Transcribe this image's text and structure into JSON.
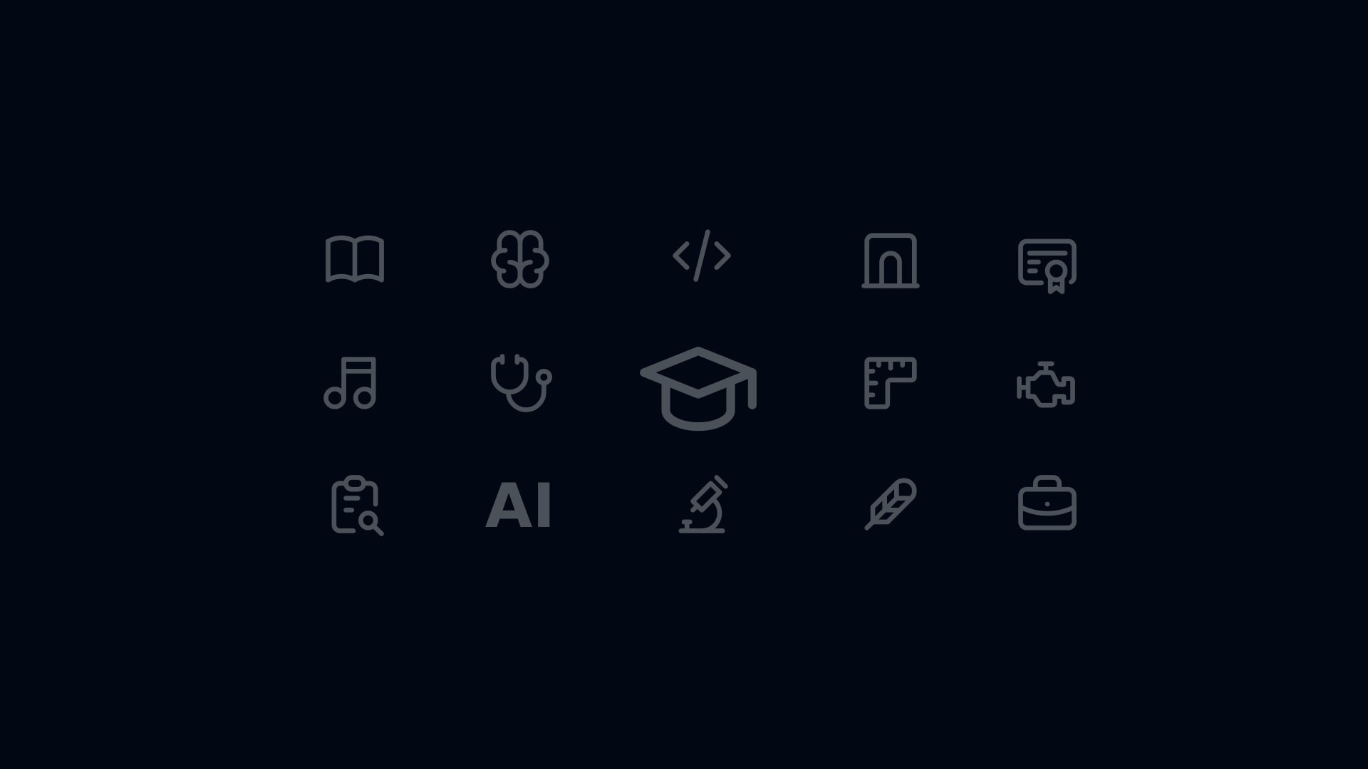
{
  "background": "#010713",
  "icon_color": "#4b5159",
  "icons": [
    {
      "name": "book-icon"
    },
    {
      "name": "brain-icon"
    },
    {
      "name": "code-icon"
    },
    {
      "name": "building-arch-icon"
    },
    {
      "name": "certificate-icon"
    },
    {
      "name": "music-icon"
    },
    {
      "name": "stethoscope-icon"
    },
    {
      "name": "graduation-cap-icon"
    },
    {
      "name": "ruler-icon"
    },
    {
      "name": "engine-icon"
    },
    {
      "name": "clipboard-search-icon"
    },
    {
      "name": "ai-icon",
      "text": "AI"
    },
    {
      "name": "microscope-icon"
    },
    {
      "name": "feather-icon"
    },
    {
      "name": "briefcase-icon"
    }
  ]
}
